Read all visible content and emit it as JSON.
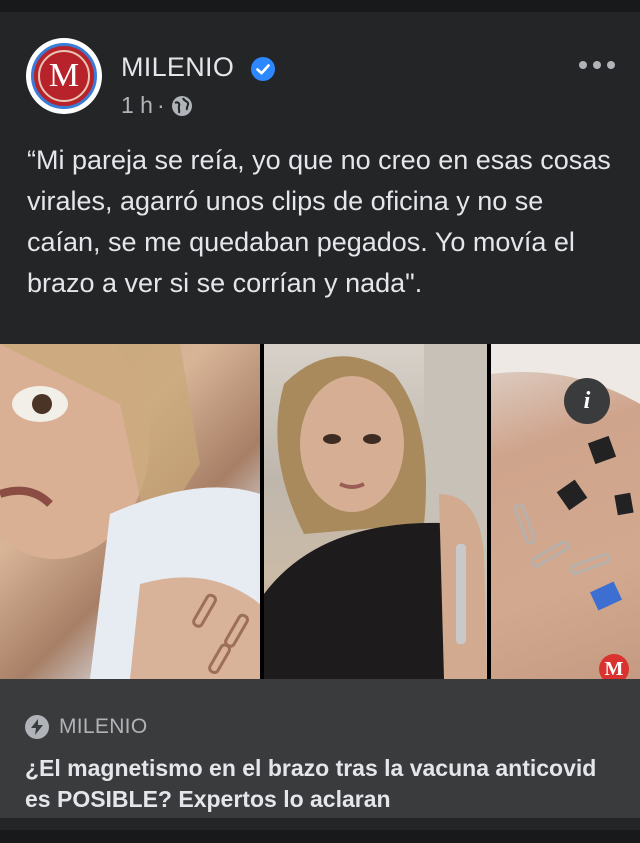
{
  "post": {
    "page_name": "MILENIO",
    "avatar_letter": "M",
    "time": "1 h",
    "separator": "·",
    "text": "“Mi pareja se reía, yo que no creo en esas cosas virales, agarró unos clips de oficina y no se caían, se me quedaban pegados. Yo movía el brazo a ver si se corrían y nada\".",
    "image": {
      "info_icon_label": "i",
      "watermark": "M"
    },
    "link": {
      "source": "MILENIO",
      "headline": "¿El magnetismo en el brazo tras la vacuna anticovid es POSIBLE? Expertos lo aclaran"
    }
  },
  "icons": {
    "verified": "verified-badge-icon",
    "audience": "globe-icon",
    "more": "more-options-icon",
    "source": "bolt-icon",
    "info": "info-icon"
  },
  "colors": {
    "background": "#18191a",
    "card": "#242526",
    "link_box": "#3a3b3c",
    "verified_blue": "#2d88ff",
    "brand_red": "#d9322f"
  }
}
